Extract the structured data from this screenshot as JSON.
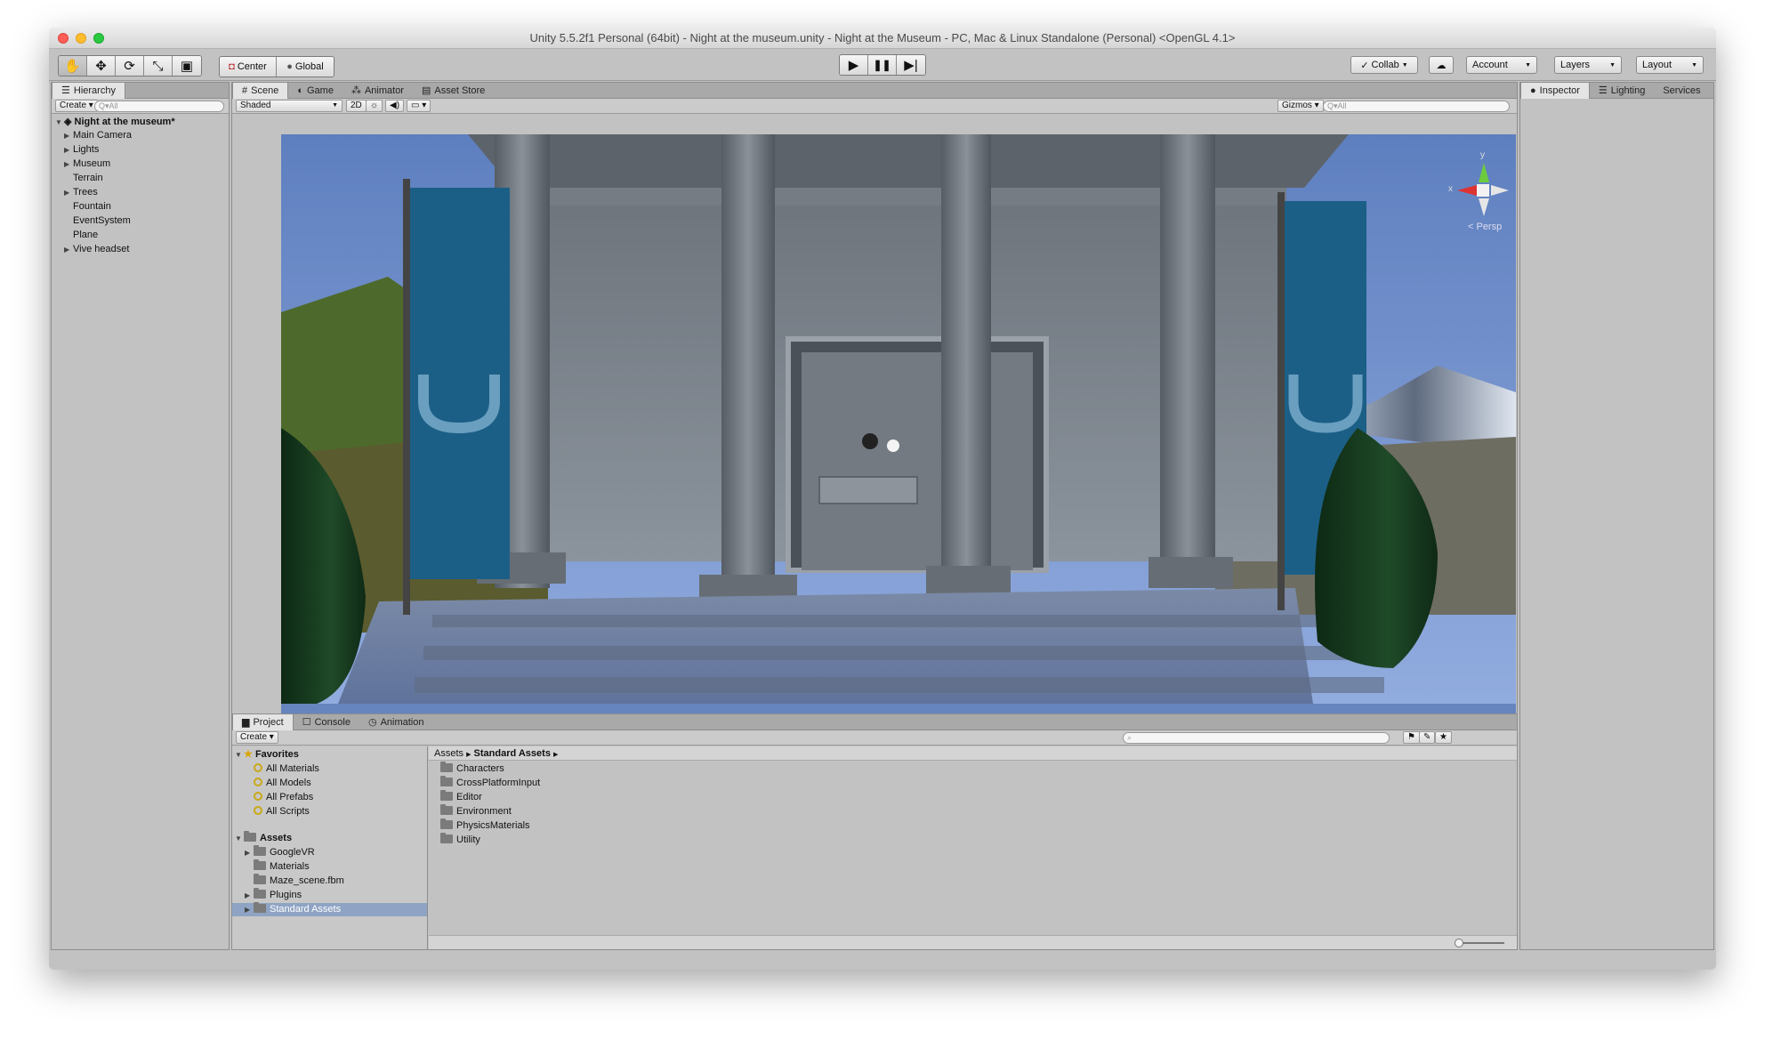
{
  "window": {
    "title": "Unity 5.5.2f1 Personal (64bit) - Night at the museum.unity - Night at the Museum - PC, Mac & Linux Standalone (Personal) <OpenGL 4.1>"
  },
  "toolbar": {
    "pivot": "Center",
    "space": "Global",
    "collab": "Collab",
    "account": "Account",
    "layers": "Layers",
    "layout": "Layout"
  },
  "hierarchy": {
    "tab": "Hierarchy",
    "create": "Create",
    "search_placeholder": "Q▾All",
    "scene_name": "Night at the museum*",
    "items": [
      {
        "label": "Main Camera",
        "expandable": true
      },
      {
        "label": "Lights",
        "expandable": true
      },
      {
        "label": "Museum",
        "expandable": true
      },
      {
        "label": "Terrain",
        "expandable": false
      },
      {
        "label": "Trees",
        "expandable": true
      },
      {
        "label": "Fountain",
        "expandable": false
      },
      {
        "label": "EventSystem",
        "expandable": false
      },
      {
        "label": "Plane",
        "expandable": false
      },
      {
        "label": "Vive headset",
        "expandable": true
      }
    ]
  },
  "scene_view": {
    "tabs": [
      "Scene",
      "Game",
      "Animator",
      "Asset Store"
    ],
    "shading": "Shaded",
    "mode_2d": "2D",
    "gizmos": "Gizmos",
    "search_placeholder": "Q▾All",
    "persp": "< Persp",
    "gizmo_axes": {
      "x": "x",
      "y": "y"
    }
  },
  "inspector": {
    "tabs": [
      "Inspector",
      "Lighting",
      "Services"
    ]
  },
  "project": {
    "tabs": [
      "Project",
      "Console",
      "Animation"
    ],
    "create": "Create",
    "favorites_label": "Favorites",
    "favorites": [
      "All Materials",
      "All Models",
      "All Prefabs",
      "All Scripts"
    ],
    "assets_label": "Assets",
    "assets": [
      {
        "label": "GoogleVR",
        "expandable": true,
        "selected": false
      },
      {
        "label": "Materials",
        "expandable": false,
        "selected": false
      },
      {
        "label": "Maze_scene.fbm",
        "expandable": false,
        "selected": false
      },
      {
        "label": "Plugins",
        "expandable": true,
        "selected": false
      },
      {
        "label": "Standard Assets",
        "expandable": true,
        "selected": true
      }
    ],
    "breadcrumb": [
      "Assets",
      "Standard Assets"
    ],
    "folder_contents": [
      "Characters",
      "CrossPlatformInput",
      "Editor",
      "Environment",
      "PhysicsMaterials",
      "Utility"
    ]
  },
  "colors": {
    "banner": "#1c5f86",
    "sky": "#6c8bc4",
    "selection": "#8fa4c4"
  }
}
